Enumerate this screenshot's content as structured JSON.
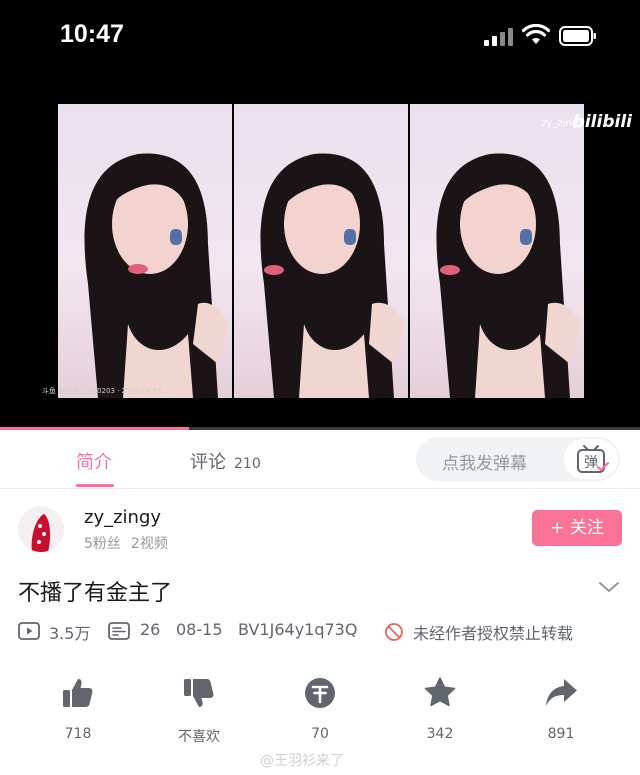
{
  "status_bar": {
    "time": "10:47"
  },
  "video": {
    "watermark_user": "zy_zingy",
    "logo": "bilibili",
    "caption": "斗鱼 房间号: 1010203 · 2021.08.15",
    "progress": 0.295
  },
  "tabs": {
    "intro_label": "简介",
    "comments_label": "评论",
    "comments_count": "210",
    "danmaku_placeholder": "点我发弹幕",
    "danmaku_icon_label": "弹"
  },
  "uploader": {
    "name": "zy_zingy",
    "fans": "5粉丝",
    "videos": "2视频",
    "follow_label": "+ 关注"
  },
  "video_info": {
    "title": "不播了有金主了",
    "views": "3.5万",
    "danmaku_count": "26",
    "date": "08-15",
    "bvid": "BV1J64y1q73Q",
    "copyright": "未经作者授权禁止转载"
  },
  "actions": {
    "like": "718",
    "dislike": "不喜欢",
    "coin": "70",
    "favorite": "342",
    "share": "891"
  },
  "footer": {
    "watermark": "@王羽衫来了"
  },
  "colors": {
    "accent": "#fb7299",
    "secondary_text": "#61666d",
    "icon_gray": "#61666d"
  }
}
